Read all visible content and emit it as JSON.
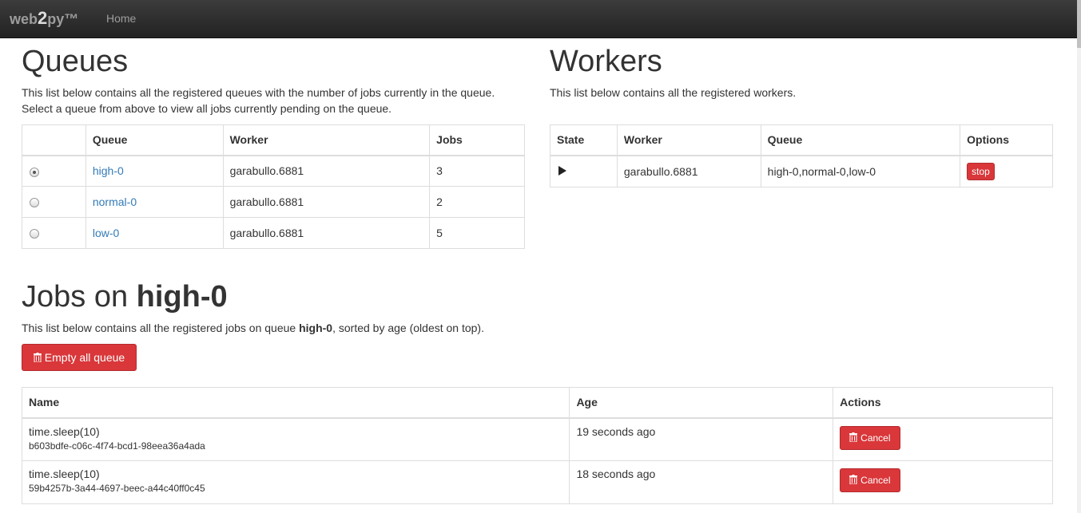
{
  "navbar": {
    "brand_prefix": "web",
    "brand_bold": "2",
    "brand_suffix": "py™",
    "home": "Home"
  },
  "queues": {
    "title": "Queues",
    "desc_line1": "This list below contains all the registered queues with the number of jobs currently in the queue.",
    "desc_line2": "Select a queue from above to view all jobs currently pending on the queue.",
    "headers": [
      "",
      "Queue",
      "Worker",
      "Jobs"
    ],
    "rows": [
      {
        "queue": "high-0",
        "worker": "garabullo.6881",
        "jobs": "3",
        "selected": true
      },
      {
        "queue": "normal-0",
        "worker": "garabullo.6881",
        "jobs": "2",
        "selected": false
      },
      {
        "queue": "low-0",
        "worker": "garabullo.6881",
        "jobs": "5",
        "selected": false
      }
    ]
  },
  "workers": {
    "title": "Workers",
    "desc": "This list below contains all the registered workers.",
    "headers": [
      "State",
      "Worker",
      "Queue",
      "Options"
    ],
    "rows": [
      {
        "state_icon": "play-icon",
        "worker": "garabullo.6881",
        "queue": "high-0,normal-0,low-0",
        "option": "stop"
      }
    ]
  },
  "jobs": {
    "title_prefix": "Jobs on ",
    "title_queue": "high-0",
    "desc_prefix": "This list below contains all the registered jobs on queue ",
    "desc_queue": "high-0",
    "desc_suffix": ", sorted by age (oldest on top).",
    "empty_button": "Empty all queue",
    "headers": [
      "Name",
      "Age",
      "Actions"
    ],
    "rows": [
      {
        "name": "time.sleep(10)",
        "id": "b603bdfe-c06c-4f74-bcd1-98eea36a4ada",
        "age": "19 seconds ago",
        "action": "Cancel"
      },
      {
        "name": "time.sleep(10)",
        "id": "59b4257b-3a44-4697-beec-a44c40ff0c45",
        "age": "18 seconds ago",
        "action": "Cancel"
      }
    ]
  },
  "colors": {
    "danger": "#d9373a",
    "link": "#337ab7",
    "navbar": "#222222"
  }
}
